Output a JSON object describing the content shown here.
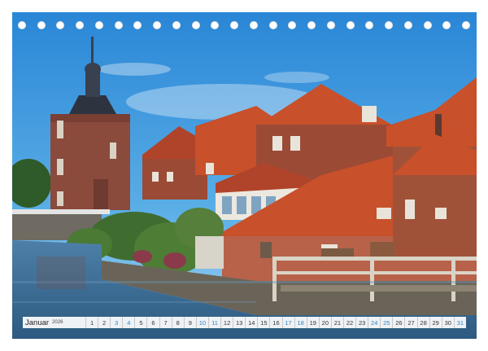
{
  "calendar": {
    "month": "Januar",
    "year": "2026",
    "days": [
      {
        "n": "1",
        "we": false
      },
      {
        "n": "2",
        "we": false
      },
      {
        "n": "3",
        "we": true
      },
      {
        "n": "4",
        "we": true
      },
      {
        "n": "5",
        "we": false
      },
      {
        "n": "6",
        "we": false
      },
      {
        "n": "7",
        "we": false
      },
      {
        "n": "8",
        "we": false
      },
      {
        "n": "9",
        "we": false
      },
      {
        "n": "10",
        "we": true
      },
      {
        "n": "11",
        "we": true
      },
      {
        "n": "12",
        "we": false
      },
      {
        "n": "13",
        "we": false
      },
      {
        "n": "14",
        "we": false
      },
      {
        "n": "15",
        "we": false
      },
      {
        "n": "16",
        "we": false
      },
      {
        "n": "17",
        "we": true
      },
      {
        "n": "18",
        "we": true
      },
      {
        "n": "19",
        "we": false
      },
      {
        "n": "20",
        "we": false
      },
      {
        "n": "21",
        "we": false
      },
      {
        "n": "22",
        "we": false
      },
      {
        "n": "23",
        "we": false
      },
      {
        "n": "24",
        "we": true
      },
      {
        "n": "25",
        "we": true
      },
      {
        "n": "26",
        "we": false
      },
      {
        "n": "27",
        "we": false
      },
      {
        "n": "28",
        "we": false
      },
      {
        "n": "29",
        "we": false
      },
      {
        "n": "30",
        "we": false
      },
      {
        "n": "31",
        "we": true
      }
    ]
  },
  "colors": {
    "sky": "#2f8fdc",
    "weekend_text": "#2e86c9",
    "roof": "#c8502a",
    "brick": "#9b4a35",
    "water": "#3d6f9a"
  },
  "binding_holes": 24
}
